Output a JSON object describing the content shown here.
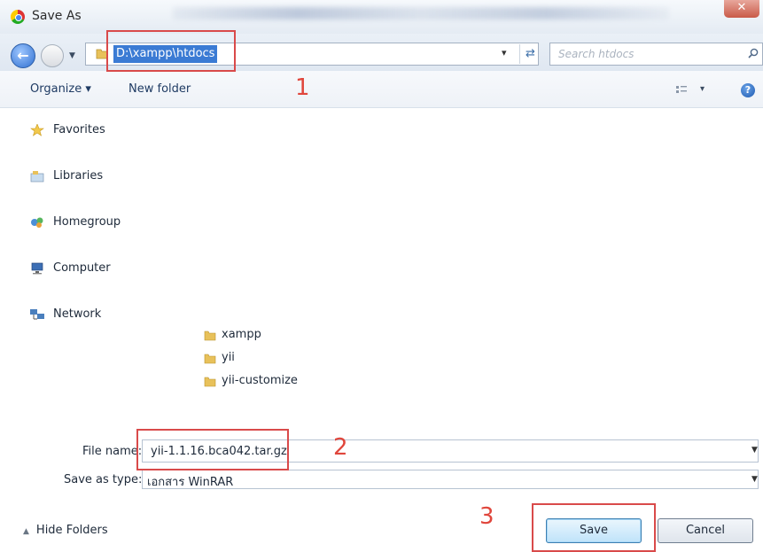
{
  "window": {
    "title": "Save As",
    "close_glyph": "✕",
    "app_icon": "chrome-icon"
  },
  "address_bar": {
    "path": "D:\\xampp\\htdocs",
    "search_placeholder": "Search htdocs"
  },
  "toolbar": {
    "organize_label": "Organize ▾",
    "new_folder_label": "New folder",
    "view_dropdown_glyph": "▾",
    "help_glyph": "?"
  },
  "nav_pane": {
    "items": [
      {
        "label": "Favorites",
        "icon": "star-icon"
      },
      {
        "label": "Libraries",
        "icon": "libraries-icon"
      },
      {
        "label": "Homegroup",
        "icon": "homegroup-icon"
      },
      {
        "label": "Computer",
        "icon": "computer-icon"
      },
      {
        "label": "Network",
        "icon": "network-icon"
      }
    ]
  },
  "folders": {
    "items": [
      {
        "label": "xampp"
      },
      {
        "label": "yii"
      },
      {
        "label": "yii-customize"
      }
    ]
  },
  "form": {
    "file_name_label": "File name:",
    "file_name_value": "yii-1.1.16.bca042.tar.gz",
    "save_type_label": "Save as type:",
    "save_type_value": "เอกสาร WinRAR"
  },
  "footer": {
    "hide_folders_label": "Hide Folders",
    "save_label": "Save",
    "cancel_label": "Cancel"
  },
  "annotations": {
    "step1": "1",
    "step2": "2",
    "step3": "3",
    "color": "#e0463c"
  }
}
